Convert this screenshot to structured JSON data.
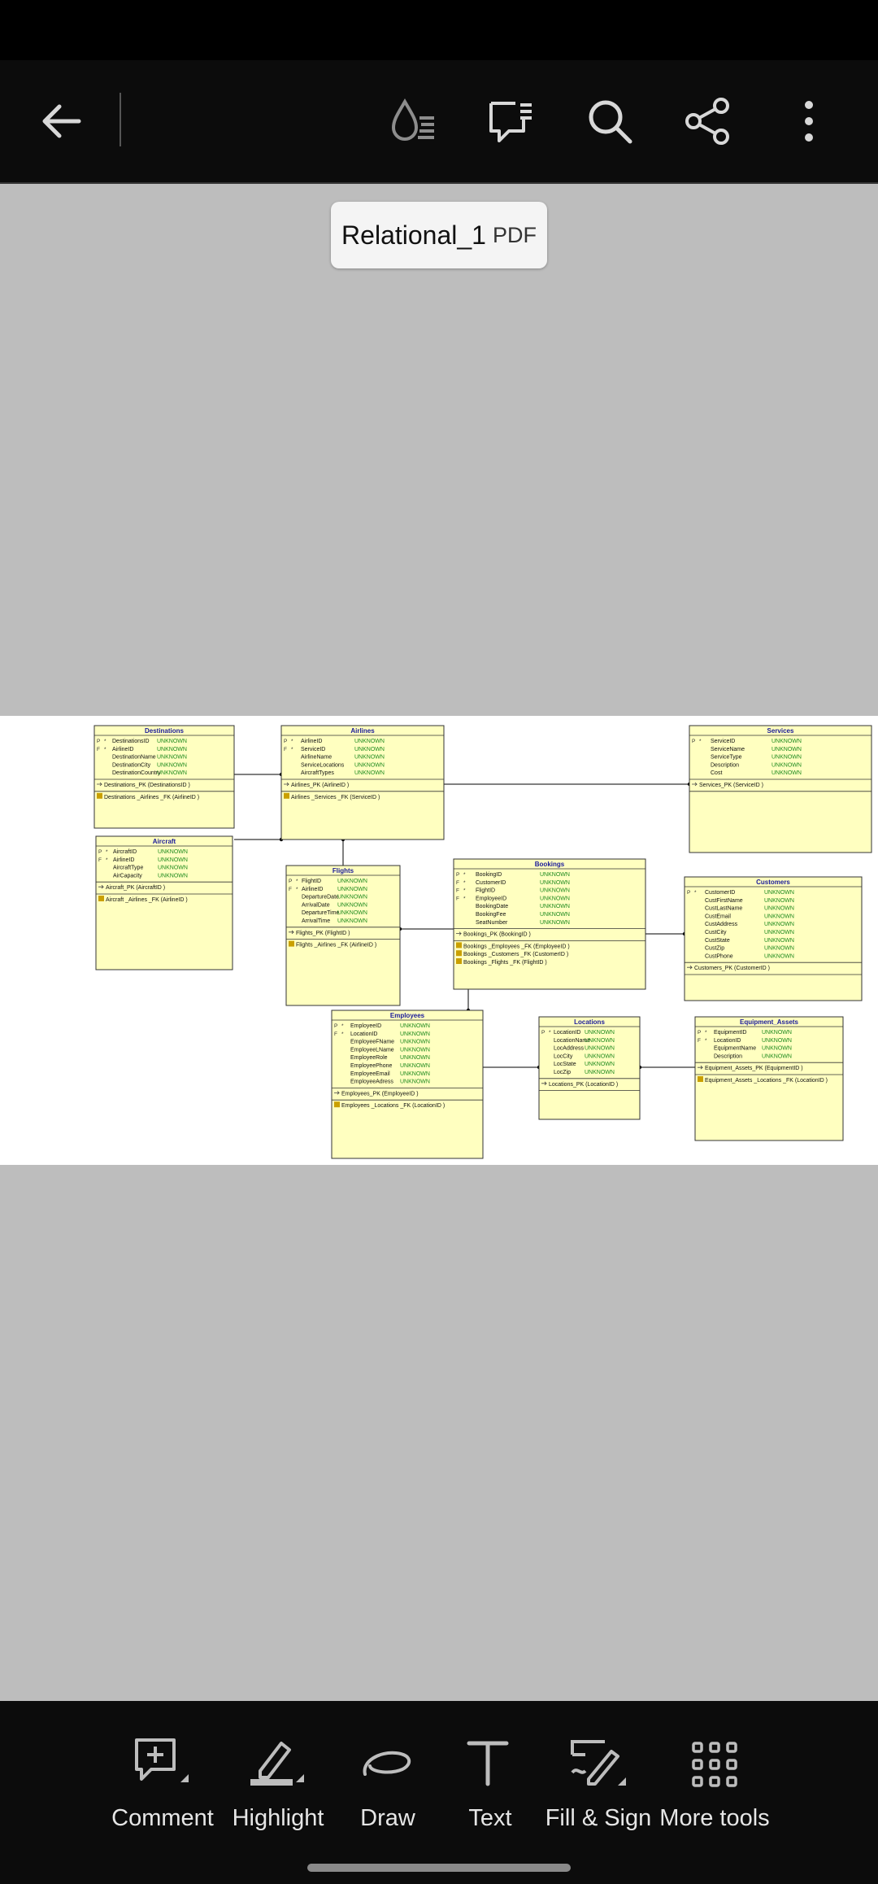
{
  "document": {
    "title": "Relational_1",
    "type": "PDF"
  },
  "toolbar_top": {
    "icons": [
      "back-arrow-icon",
      "read-mode-icon",
      "comments-icon",
      "search-icon",
      "share-icon",
      "more-vertical-icon"
    ]
  },
  "tools": [
    {
      "label": "Comment",
      "icon": "add-comment-icon"
    },
    {
      "label": "Highlight",
      "icon": "highlighter-icon"
    },
    {
      "label": "Draw",
      "icon": "draw-icon"
    },
    {
      "label": "Text",
      "icon": "text-icon"
    },
    {
      "label": "Fill & Sign",
      "icon": "fill-sign-icon"
    },
    {
      "label": "More tools",
      "icon": "grid-icon"
    }
  ],
  "diagram": {
    "type_label": "UNKNOWN",
    "tables": [
      {
        "name": "Destinations",
        "columns": [
          {
            "k": "P",
            "r": "*",
            "n": "DestinationsID"
          },
          {
            "k": "F",
            "r": "*",
            "n": "AirlineID"
          },
          {
            "k": "",
            "r": "",
            "n": "DestinationName"
          },
          {
            "k": "",
            "r": "",
            "n": "DestinationCity"
          },
          {
            "k": "",
            "r": "",
            "n": "DestinationCountry"
          }
        ],
        "keys": [
          "Destinations_PK (DestinationsID )"
        ],
        "fks": [
          "Destinations _Airlines _FK (AirlineID )"
        ]
      },
      {
        "name": "Airlines",
        "columns": [
          {
            "k": "P",
            "r": "*",
            "n": "AirlineID"
          },
          {
            "k": "F",
            "r": "*",
            "n": "ServiceID"
          },
          {
            "k": "",
            "r": "",
            "n": "AirlineName"
          },
          {
            "k": "",
            "r": "",
            "n": "ServiceLocations"
          },
          {
            "k": "",
            "r": "",
            "n": "AircraftTypes"
          }
        ],
        "keys": [
          "Airlines_PK (AirlineID )"
        ],
        "fks": [
          "Airlines _Services _FK (ServiceID )"
        ]
      },
      {
        "name": "Services",
        "columns": [
          {
            "k": "P",
            "r": "*",
            "n": "ServiceID"
          },
          {
            "k": "",
            "r": "",
            "n": "ServiceName"
          },
          {
            "k": "",
            "r": "",
            "n": "ServiceType"
          },
          {
            "k": "",
            "r": "",
            "n": "Description"
          },
          {
            "k": "",
            "r": "",
            "n": "Cost"
          }
        ],
        "keys": [
          "Services_PK (ServiceID )"
        ],
        "fks": []
      },
      {
        "name": "Aircraft",
        "columns": [
          {
            "k": "P",
            "r": "*",
            "n": "AircraftID"
          },
          {
            "k": "F",
            "r": "*",
            "n": "AirlineID"
          },
          {
            "k": "",
            "r": "",
            "n": "AircraftType"
          },
          {
            "k": "",
            "r": "",
            "n": "AirCapacity"
          }
        ],
        "keys": [
          "Aircraft_PK (AircraftID )"
        ],
        "fks": [
          "Aircraft _Airlines _FK (AirlineID )"
        ]
      },
      {
        "name": "Flights",
        "columns": [
          {
            "k": "P",
            "r": "*",
            "n": "FlightID"
          },
          {
            "k": "F",
            "r": "*",
            "n": "AirlineID"
          },
          {
            "k": "",
            "r": "",
            "n": "DepartureDate"
          },
          {
            "k": "",
            "r": "",
            "n": "ArrivalDate"
          },
          {
            "k": "",
            "r": "",
            "n": "DepartureTime"
          },
          {
            "k": "",
            "r": "",
            "n": "ArrivalTime"
          }
        ],
        "keys": [
          "Flights_PK (FlightID )"
        ],
        "fks": [
          "Flights _Airlines _FK (AirlineID )"
        ]
      },
      {
        "name": "Bookings",
        "columns": [
          {
            "k": "P",
            "r": "*",
            "n": "BookingID"
          },
          {
            "k": "F",
            "r": "*",
            "n": "CustomerID"
          },
          {
            "k": "F",
            "r": "*",
            "n": "FlightID"
          },
          {
            "k": "F",
            "r": "*",
            "n": "EmployeeID"
          },
          {
            "k": "",
            "r": "",
            "n": "BookingDate"
          },
          {
            "k": "",
            "r": "",
            "n": "BookingFee"
          },
          {
            "k": "",
            "r": "",
            "n": "SeatNumber"
          }
        ],
        "keys": [
          "Bookings_PK (BookingID )"
        ],
        "fks": [
          "Bookings _Employees _FK (EmployeeID )",
          "Bookings _Customers _FK (CustomerID )",
          "Bookings _Flights _FK (FlightID )"
        ]
      },
      {
        "name": "Customers",
        "columns": [
          {
            "k": "P",
            "r": "*",
            "n": "CustomerID"
          },
          {
            "k": "",
            "r": "",
            "n": "CustFirstName"
          },
          {
            "k": "",
            "r": "",
            "n": "CustLastName"
          },
          {
            "k": "",
            "r": "",
            "n": "CustEmail"
          },
          {
            "k": "",
            "r": "",
            "n": "CustAddress"
          },
          {
            "k": "",
            "r": "",
            "n": "CustCity"
          },
          {
            "k": "",
            "r": "",
            "n": "CustState"
          },
          {
            "k": "",
            "r": "",
            "n": "CustZip"
          },
          {
            "k": "",
            "r": "",
            "n": "CustPhone"
          }
        ],
        "keys": [
          "Customers_PK (CustomerID )"
        ],
        "fks": []
      },
      {
        "name": "Employees",
        "columns": [
          {
            "k": "P",
            "r": "*",
            "n": "EmployeeID"
          },
          {
            "k": "F",
            "r": "*",
            "n": "LocationID"
          },
          {
            "k": "",
            "r": "",
            "n": "EmployeeFName"
          },
          {
            "k": "",
            "r": "",
            "n": "EmployeeLName"
          },
          {
            "k": "",
            "r": "",
            "n": "EmployeeRole"
          },
          {
            "k": "",
            "r": "",
            "n": "EmployeePhone"
          },
          {
            "k": "",
            "r": "",
            "n": "EmployeeEmail"
          },
          {
            "k": "",
            "r": "",
            "n": "EmployeeAdress"
          }
        ],
        "keys": [
          "Employees_PK (EmployeeID )"
        ],
        "fks": [
          "Employees _Locations _FK (LocationID )"
        ]
      },
      {
        "name": "Locations",
        "columns": [
          {
            "k": "P",
            "r": "*",
            "n": "LocationID"
          },
          {
            "k": "",
            "r": "",
            "n": "LocationName"
          },
          {
            "k": "",
            "r": "",
            "n": "LocAddress"
          },
          {
            "k": "",
            "r": "",
            "n": "LocCity"
          },
          {
            "k": "",
            "r": "",
            "n": "LocState"
          },
          {
            "k": "",
            "r": "",
            "n": "LocZip"
          }
        ],
        "keys": [
          "Locations_PK (LocationID )"
        ],
        "fks": []
      },
      {
        "name": "Equipment_Assets",
        "columns": [
          {
            "k": "P",
            "r": "*",
            "n": "EquipmentID"
          },
          {
            "k": "F",
            "r": "*",
            "n": "LocationID"
          },
          {
            "k": "",
            "r": "",
            "n": "EquipmentName"
          },
          {
            "k": "",
            "r": "",
            "n": "Description"
          }
        ],
        "keys": [
          "Equipment_Assets_PK (EquipmentID )"
        ],
        "fks": [
          "Equipment_Assets _Locations _FK (LocationID )"
        ]
      }
    ]
  }
}
